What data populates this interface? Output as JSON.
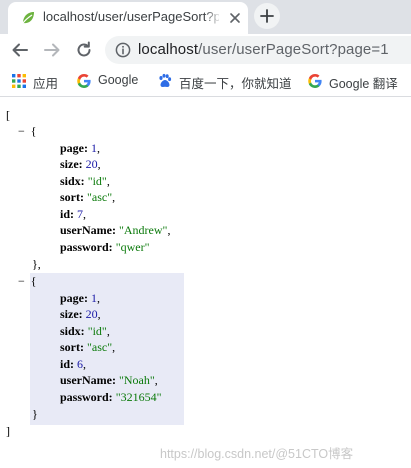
{
  "tab": {
    "title": "localhost/user/userPageSort?p",
    "favicon": "spring-leaf-icon"
  },
  "toolbar": {
    "url_host": "localhost",
    "url_path": "/user/userPageSort?page=1"
  },
  "bookmarks": [
    {
      "label": "应用",
      "icon": "apps-grid-icon"
    },
    {
      "label": "Google",
      "icon": "google-g-icon"
    },
    {
      "label": "百度一下，你就知道",
      "icon": "baidu-paw-icon"
    },
    {
      "label": "Google 翻译",
      "icon": "google-g-icon"
    }
  ],
  "json_view": {
    "open_bracket": "[",
    "close_bracket": "]",
    "items": [
      {
        "page": "1",
        "size": "20",
        "sidx": "\"id\"",
        "sort": "\"asc\"",
        "id": "7",
        "userName": "\"Andrew\"",
        "password": "\"qwer\""
      },
      {
        "page": "1",
        "size": "20",
        "sidx": "\"id\"",
        "sort": "\"asc\"",
        "id": "6",
        "userName": "\"Noah\"",
        "password": "\"321654\""
      }
    ]
  },
  "watermark": "https://blog.csdn.net/@51CTO博客",
  "colors": {
    "key": "#000000",
    "number": "#1a1aa6",
    "string": "#0b7a0b",
    "highlight": "#e8eaf6"
  }
}
